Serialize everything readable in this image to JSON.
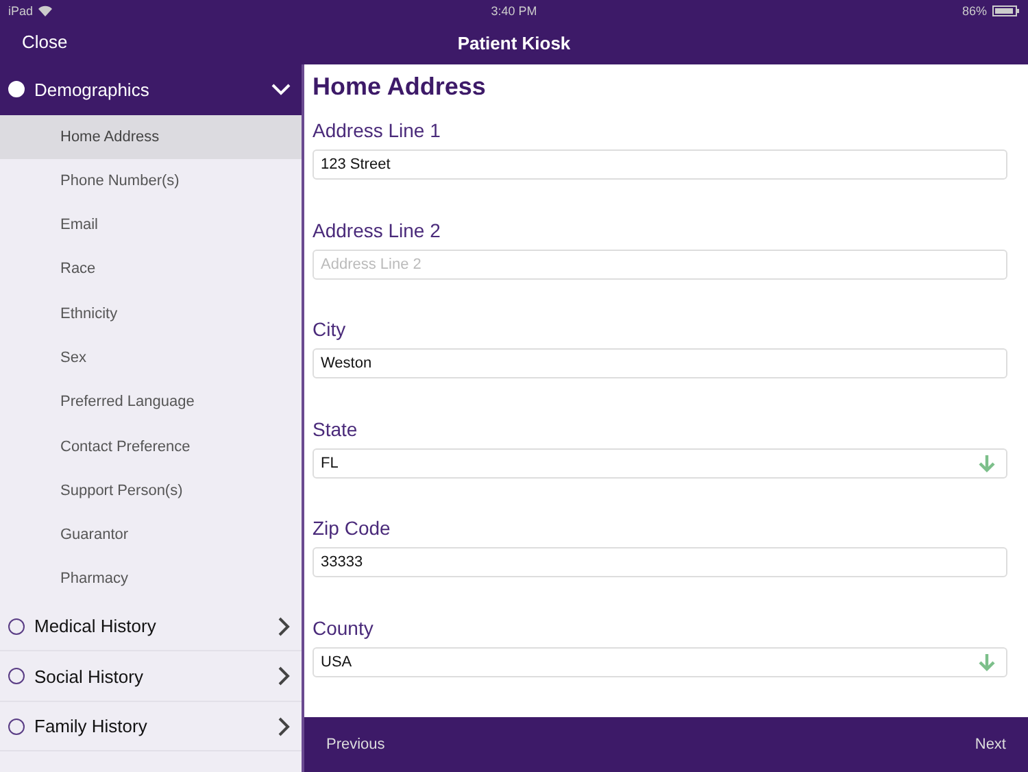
{
  "status_bar": {
    "device": "iPad",
    "time": "3:40 PM",
    "battery": "86%"
  },
  "nav_bar": {
    "left_button": "Close",
    "title": "Patient Kiosk"
  },
  "sidebar": {
    "sections": [
      {
        "label": "Demographics",
        "expanded": true,
        "items": [
          {
            "label": "Home Address",
            "selected": true
          },
          {
            "label": "Phone Number(s)",
            "selected": false
          },
          {
            "label": "Email",
            "selected": false
          },
          {
            "label": "Race",
            "selected": false
          },
          {
            "label": "Ethnicity",
            "selected": false
          },
          {
            "label": "Sex",
            "selected": false
          },
          {
            "label": "Preferred Language",
            "selected": false
          },
          {
            "label": "Contact Preference",
            "selected": false
          },
          {
            "label": "Support Person(s)",
            "selected": false
          },
          {
            "label": "Guarantor",
            "selected": false
          },
          {
            "label": "Pharmacy",
            "selected": false
          }
        ]
      },
      {
        "label": "Medical History",
        "expanded": false
      },
      {
        "label": "Social History",
        "expanded": false
      },
      {
        "label": "Family History",
        "expanded": false
      }
    ]
  },
  "form": {
    "title": "Home Address",
    "fields": [
      {
        "label": "Address Line 1",
        "kind": "text",
        "value": "123 Street"
      },
      {
        "label": "Address Line 2",
        "kind": "text",
        "placeholder": "Address Line 2"
      },
      {
        "label": "City",
        "kind": "text",
        "value": "Weston"
      },
      {
        "label": "State",
        "kind": "select",
        "value": "FL"
      },
      {
        "label": "Zip Code",
        "kind": "text",
        "value": "33333"
      },
      {
        "label": "County",
        "kind": "select",
        "value": "USA"
      }
    ]
  },
  "footer": {
    "previous": "Previous",
    "next": "Next"
  }
}
